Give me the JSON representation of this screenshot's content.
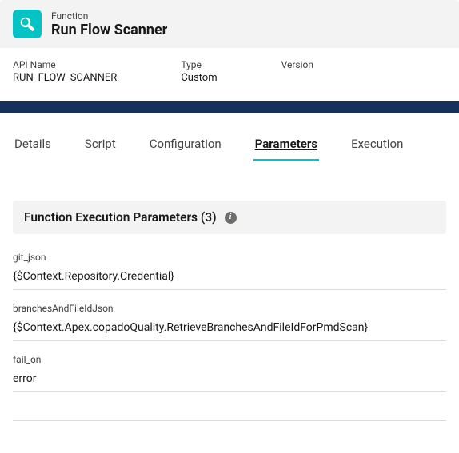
{
  "header": {
    "objectLabel": "Function",
    "title": "Run Flow Scanner"
  },
  "meta": {
    "apiName": {
      "label": "API Name",
      "value": "RUN_FLOW_SCANNER"
    },
    "type": {
      "label": "Type",
      "value": "Custom"
    },
    "version": {
      "label": "Version",
      "value": ""
    }
  },
  "tabs": {
    "details": "Details",
    "script": "Script",
    "configuration": "Configuration",
    "parameters": "Parameters",
    "execution": "Execution"
  },
  "section": {
    "title": "Function Execution Parameters (3)"
  },
  "params": [
    {
      "label": "git_json",
      "value": "{$Context.Repository.Credential}"
    },
    {
      "label": "branchesAndFileIdJson",
      "value": "{$Context.Apex.copadoQuality.RetrieveBranchesAndFileIdForPmdScan}"
    },
    {
      "label": "fail_on",
      "value": "error"
    }
  ]
}
